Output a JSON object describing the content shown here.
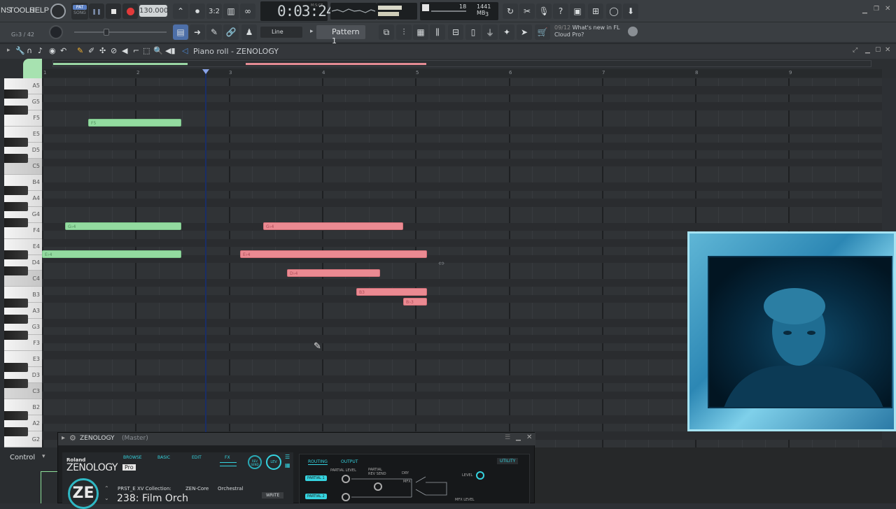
{
  "menu": {
    "items": [
      "NS",
      "TOOLS",
      "HELP"
    ]
  },
  "transport": {
    "pat_label": "PAT",
    "song_label": "SONG",
    "tempo": "130.000",
    "time": "0:03:24",
    "time_unit_label": "M:S:CS"
  },
  "hint_bar": {
    "note_info": "G♭3 / 42"
  },
  "cpu": {
    "voices": "18",
    "memory": "1441 MB",
    "count": "3"
  },
  "snap": {
    "label": "Line"
  },
  "pattern": {
    "label": "Pattern 1"
  },
  "news": {
    "date": "09/12",
    "text_line1": "What's new in FL",
    "text_line2": "Cloud Pro?"
  },
  "piano_roll": {
    "title": "Piano roll - ZENOLOGY"
  },
  "ruler_numbers": [
    "1",
    "2",
    "3",
    "4",
    "5",
    "6",
    "7",
    "8",
    "9"
  ],
  "keys": [
    "A5",
    "G5",
    "F5",
    "E5",
    "D5",
    "C5",
    "B4",
    "A4",
    "G4",
    "F4",
    "E4",
    "D4",
    "C4",
    "B3",
    "A3",
    "G3",
    "F3",
    "E3",
    "D3",
    "C3",
    "B2",
    "A2",
    "G2"
  ],
  "notes_green": [
    {
      "label": "F5"
    },
    {
      "label": "G♭4"
    },
    {
      "label": "E♭4"
    }
  ],
  "notes_red": [
    {
      "label": "G♭4"
    },
    {
      "label": "E♭4"
    },
    {
      "label": "D♭4"
    },
    {
      "label": "B3"
    },
    {
      "label": "B♭3"
    }
  ],
  "control": {
    "label": "Control"
  },
  "zenology": {
    "window_title": "ZENOLOGY",
    "window_sub": "(Master)",
    "brand": "Roland",
    "product": "ZENOLOGY",
    "edition": "Pro",
    "tabs": [
      "BROWSE",
      "BASIC",
      "EDIT",
      "FX"
    ],
    "rev_send": "REV SEND",
    "lev": "LEV",
    "preset_line": "PRST_E XV Collection:",
    "zen_core": "ZEN-Core",
    "category": "Orchestral",
    "write": "WRITE",
    "patch_number": "238:",
    "patch_name": "Film Orch",
    "routing_tabs": [
      "ROUTING",
      "OUTPUT"
    ],
    "utility": "UTILITY",
    "partial_level": "PARTIAL LEVEL",
    "partial_rev_send": "PARTIAL REV SEND",
    "dry": "DRY",
    "mfx": "MFX",
    "level": "LEVEL",
    "mfx_level": "MFX LEVEL",
    "partial1": "PARTIAL 1",
    "partial2": "PARTIAL 2"
  }
}
